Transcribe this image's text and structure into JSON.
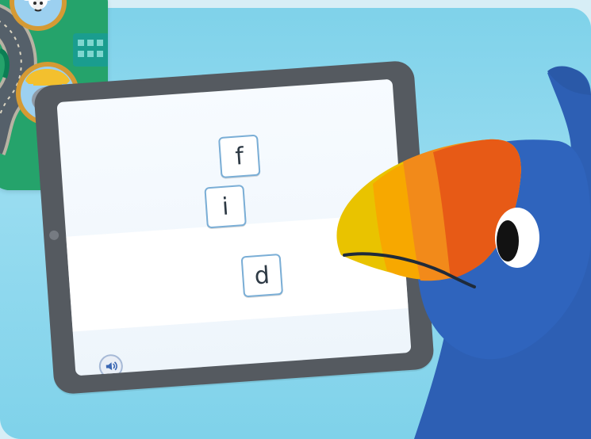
{
  "tiles": [
    {
      "letter": "f"
    },
    {
      "letter": "i"
    },
    {
      "letter": "d"
    }
  ],
  "icons": {
    "map_badge_1": "sheep-avatar-icon",
    "map_badge_2": "worker-dog-avatar-icon",
    "map_building": "building-icon",
    "audio": "speaker-icon",
    "mascot": "toucan-icon"
  },
  "colors": {
    "background": "#7fd2ea",
    "map": "#25a36b",
    "tile_border": "#7aaed6",
    "tablet_bezel": "#555a60",
    "toucan_body": "#2d5fb4"
  }
}
